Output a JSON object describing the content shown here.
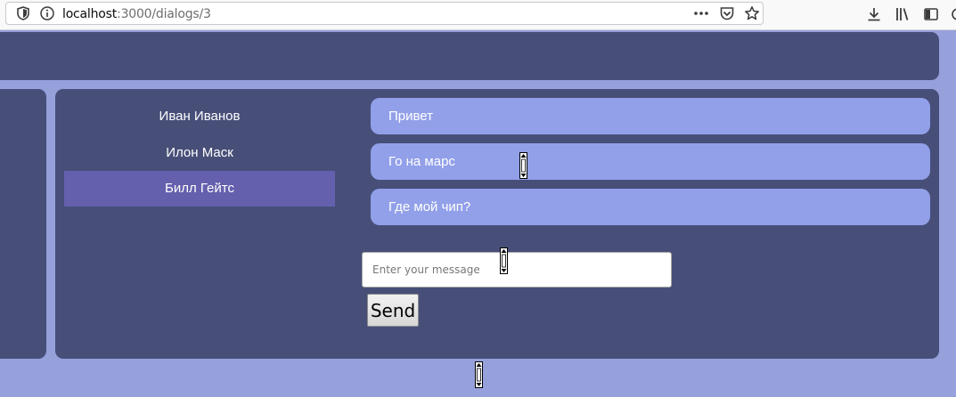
{
  "browser": {
    "url_host": "localhost",
    "url_path": ":3000/dialogs/3",
    "icons": [
      "shield-icon",
      "info-icon",
      "more-icon",
      "pocket-icon",
      "star-icon",
      "download-icon",
      "library-icon",
      "sidebar-icon"
    ]
  },
  "dialogs": [
    {
      "name": "Иван Иванов",
      "active": false
    },
    {
      "name": "Илон Маск",
      "active": false
    },
    {
      "name": "Билл Гейтс",
      "active": true
    }
  ],
  "messages": [
    {
      "text": "Привет"
    },
    {
      "text": "Го на марс"
    },
    {
      "text": "Где мой чип?"
    }
  ],
  "composer": {
    "placeholder": "Enter your message",
    "send_label": "Send"
  },
  "colors": {
    "page_bg": "#96a0db",
    "panel_bg": "#474f79",
    "active_dialog": "#6460ad",
    "message_bg": "#92a0e9"
  }
}
